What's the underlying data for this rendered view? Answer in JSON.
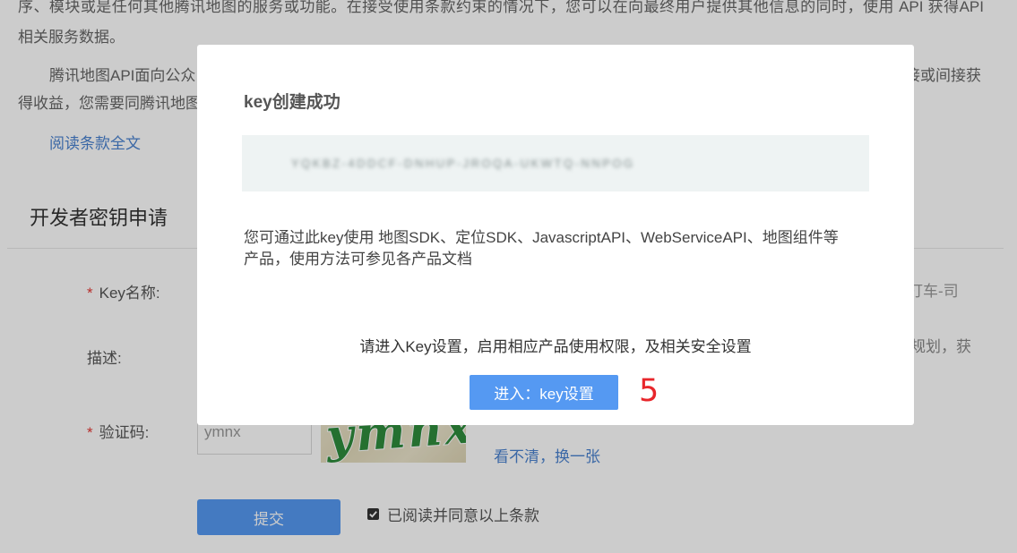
{
  "background": {
    "terms": {
      "line1": "序、模块或是任何其他腾讯地图的服务或功能。在接受使用条款约束的情况下，您可以在向最终用户提供其他信息的同时，使用 API 获得API",
      "line2": "相关服务数据。",
      "para2_line1_left": "腾讯地图API面向公众",
      "para2_line1_right": "接或间接获",
      "para2_line2": "得收益，您需要同腾讯地图",
      "read_full_link": "阅读条款全文"
    },
    "form": {
      "heading": "开发者密钥申请",
      "key_name": {
        "required_mark": "*",
        "label": "Key名称:",
        "hint": "打车-司"
      },
      "description": {
        "label": "描述:",
        "hint": "规划，获"
      },
      "captcha": {
        "required_mark": "*",
        "label": "验证码:",
        "input_value": "ymnx",
        "image_text": "ymnx",
        "refresh_link": "看不清，换一张"
      },
      "submit_label": "提交",
      "agree": {
        "checked": true,
        "label": "已阅读并同意以上条款",
        "icon": "checkmark-icon"
      }
    }
  },
  "modal": {
    "title": "key创建成功",
    "key_value": "YQKBZ-4DDCF-DNHUP-JROQA-UKWTQ-NNPOG",
    "description_line1": "您可通过此key使用 地图SDK、定位SDK、JavascriptAPI、WebServiceAPI、地图组件等",
    "description_line2": "产品，使用方法可参见各产品文档",
    "instruction": "请进入Key设置，启用相应产品使用权限，及相关安全设置",
    "button_label": "进入：key设置",
    "annotation": "5"
  },
  "colors": {
    "accent_blue": "#5599f2",
    "link_blue": "#4a82d0",
    "required_red": "#e53935",
    "annotation_red": "#e8262b",
    "key_box_bg": "#eef3f3",
    "overlay": "rgba(0,0,0,0.2)"
  }
}
